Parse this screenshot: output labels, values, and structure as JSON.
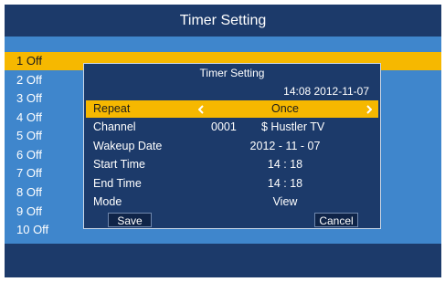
{
  "header": {
    "title": "Timer Setting"
  },
  "timer_list": [
    {
      "label": "1 Off"
    },
    {
      "label": "2 Off"
    },
    {
      "label": "3 Off"
    },
    {
      "label": "4 Off"
    },
    {
      "label": "5 Off"
    },
    {
      "label": "6 Off"
    },
    {
      "label": "7 Off"
    },
    {
      "label": "8 Off"
    },
    {
      "label": "9 Off"
    },
    {
      "label": "10 Off"
    }
  ],
  "dialog": {
    "title": "Timer Setting",
    "current_time": "14:08 2012-11-07",
    "repeat": {
      "label": "Repeat",
      "value": "Once"
    },
    "channel": {
      "label": "Channel",
      "number": "0001",
      "name": "$ Hustler TV"
    },
    "wakeup_date": {
      "label": "Wakeup Date",
      "value": "2012 - 11 - 07"
    },
    "start_time": {
      "label": "Start Time",
      "value": "14 : 18"
    },
    "end_time": {
      "label": "End Time",
      "value": "14 : 18"
    },
    "mode": {
      "label": "Mode",
      "value": "View"
    },
    "save_label": "Save",
    "cancel_label": "Cancel"
  },
  "colors": {
    "panel_dark": "#1c3a6a",
    "background_blue": "#3f86cc",
    "highlight": "#f6b800",
    "button_dark": "#0f2448"
  },
  "icons": {
    "left": "chevron-left-icon",
    "right": "chevron-right-icon"
  }
}
